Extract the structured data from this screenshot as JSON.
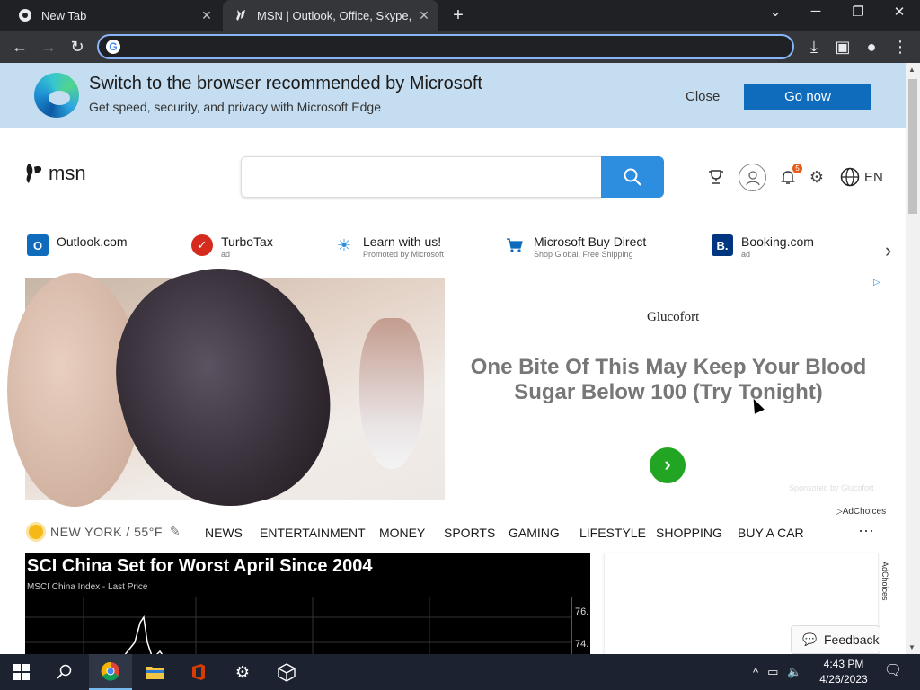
{
  "browser": {
    "tabs": [
      {
        "title": "New Tab",
        "icon": "chrome-icon"
      },
      {
        "title": "MSN | Outlook, Office, Skype, Bing",
        "icon": "msn-icon"
      }
    ],
    "address": {
      "value": "",
      "placeholder": ""
    }
  },
  "banner": {
    "title": "Switch to the browser recommended by Microsoft",
    "subtitle": "Get speed, security, and privacy with Microsoft Edge",
    "close_label": "Close",
    "go_label": "Go now"
  },
  "header": {
    "logo_text": "msn",
    "search_placeholder": "",
    "notification_count": "5",
    "language": "EN"
  },
  "quicklinks": [
    {
      "label": "Outlook.com",
      "sub": "",
      "icon": "outlook-icon",
      "color": "#0f6cbd"
    },
    {
      "label": "TurboTax",
      "sub": "ad",
      "icon": "turbotax-icon",
      "color": "#d52b1e"
    },
    {
      "label": "Learn with us!",
      "sub": "Promoted by Microsoft",
      "icon": "lightbulb-icon",
      "color": "#2d8ee0"
    },
    {
      "label": "Microsoft Buy Direct",
      "sub": "Shop Global, Free Shipping",
      "icon": "cart-icon",
      "color": "#0f6cbd"
    },
    {
      "label": "Booking.com",
      "sub": "ad",
      "icon": "booking-icon",
      "color": "#003580"
    }
  ],
  "ad": {
    "brand": "Glucofort",
    "headline": "One Bite Of This May Keep Your Blood Sugar Below 100 (Try Tonight)",
    "sponsor": "Sponsored by Glucofort",
    "adchoices": "AdChoices"
  },
  "weather": {
    "location": "NEW YORK / 55°F"
  },
  "nav": [
    "NEWS",
    "ENTERTAINMENT",
    "MONEY",
    "SPORTS",
    "GAMING",
    "LIFESTYLE",
    "SHOPPING",
    "BUY A CAR"
  ],
  "news": {
    "title": "SCI China Set for Worst April Since 2004",
    "subtitle": "MSCI China Index - Last Price",
    "axis_labels": [
      "76.",
      "74."
    ]
  },
  "side_adchoices": "AdChoices",
  "feedback_label": "Feedback",
  "taskbar": {
    "time": "4:43 PM",
    "date": "4/26/2023"
  }
}
